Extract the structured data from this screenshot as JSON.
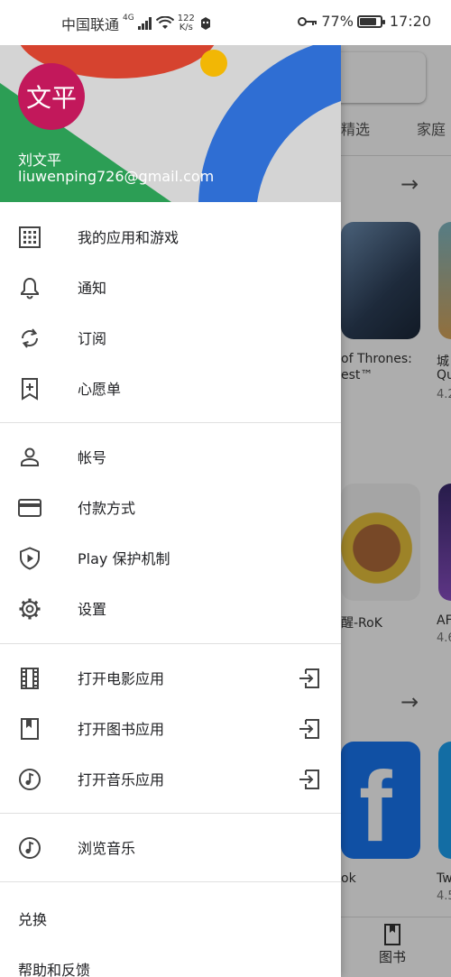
{
  "status_bar": {
    "carrier": "中国联通",
    "network": "4G",
    "speed_value": "122",
    "speed_unit": "K/s",
    "battery": "77%",
    "battery_level": 0.77,
    "time": "17:20"
  },
  "background": {
    "tab_featured": "精选",
    "tab_family": "家庭",
    "app1_title_line1": "of Thrones:",
    "app1_title_line2": "est™",
    "app2_title_line1": "城",
    "app2_title_line2": "Qu",
    "app2_rating": "4.2",
    "app3_title": "醒-RoK",
    "app4_title": "AF",
    "app4_rating": "4.6",
    "app5_title": "ok",
    "app6_title": "Tw",
    "app6_rating": "4.5",
    "bottom_nav_books": "图书"
  },
  "drawer": {
    "avatar_text": "文平",
    "user_name": "刘文平",
    "user_email": "liuwenping726@gmail.com",
    "section1": [
      {
        "label": "我的应用和游戏",
        "icon": "grid-icon"
      },
      {
        "label": "通知",
        "icon": "bell-icon"
      },
      {
        "label": "订阅",
        "icon": "refresh-icon"
      },
      {
        "label": "心愿单",
        "icon": "bookmark-add-icon"
      }
    ],
    "section2": [
      {
        "label": "帐号",
        "icon": "person-icon"
      },
      {
        "label": "付款方式",
        "icon": "credit-card-icon"
      },
      {
        "label": "Play 保护机制",
        "icon": "shield-play-icon"
      },
      {
        "label": "设置",
        "icon": "gear-icon"
      }
    ],
    "section3": [
      {
        "label": "打开电影应用",
        "icon": "film-icon",
        "trail_icon": "open-app-icon"
      },
      {
        "label": "打开图书应用",
        "icon": "book-icon",
        "trail_icon": "open-app-icon"
      },
      {
        "label": "打开音乐应用",
        "icon": "music-icon",
        "trail_icon": "open-app-icon"
      }
    ],
    "section4": [
      {
        "label": "浏览音乐",
        "icon": "music-icon"
      }
    ],
    "redeem": "兑换",
    "help": "帮助和反馈"
  }
}
